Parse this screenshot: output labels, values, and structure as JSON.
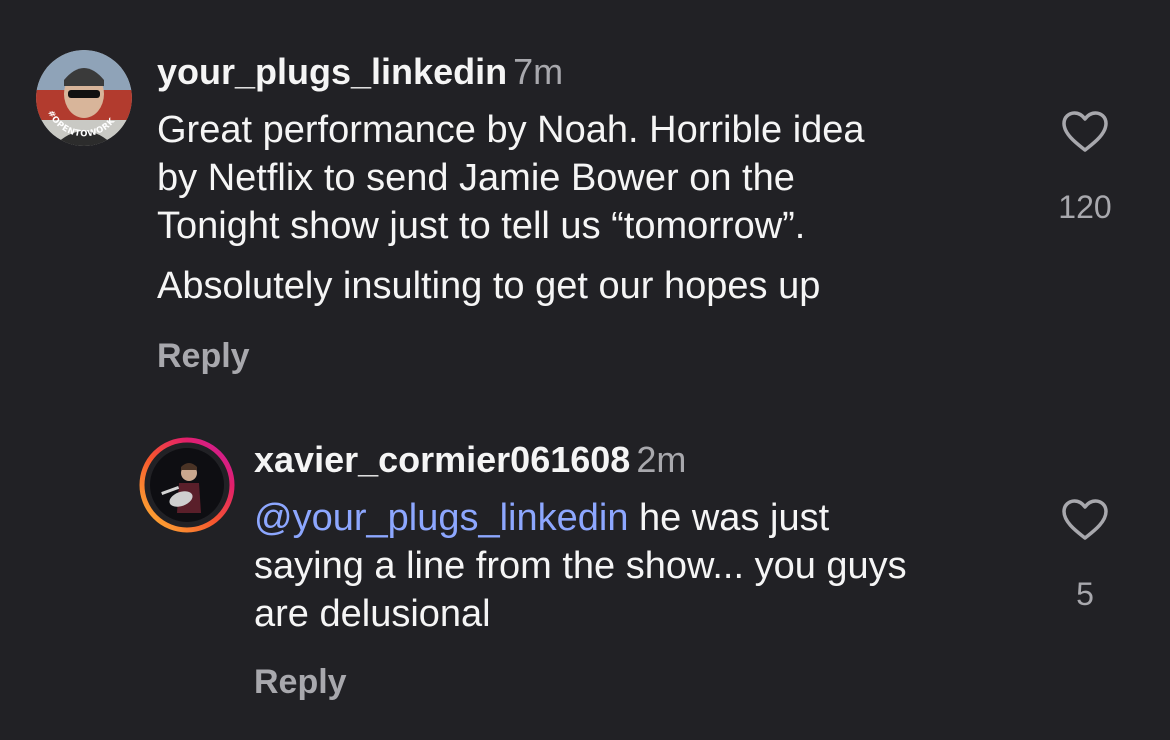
{
  "comments": [
    {
      "username": "your_plugs_linkedin",
      "time": "7m",
      "text_lines": [
        "Great performance by Noah. Horrible idea",
        "by Netflix to send Jamie Bower on the",
        "Tonight show just to tell us “tomorrow”."
      ],
      "text_para2": "Absolutely insulting to get our hopes up",
      "reply_label": "Reply",
      "likes": "120",
      "avatar_badge": "#OPENTOWORK"
    },
    {
      "username": "xavier_cormier061608",
      "time": "2m",
      "mention": "@your_plugs_linkedin",
      "text_rest_line1": " he was just",
      "text_lines": [
        "saying a line from the show... you guys",
        "are delusional"
      ],
      "reply_label": "Reply",
      "likes": "5"
    }
  ],
  "colors": {
    "background": "#212125",
    "primary_text": "#f5f5f5",
    "secondary_text": "#a8a8ad",
    "mention": "#8da7ff",
    "open_to_work_ring": "#3f8a3b"
  }
}
